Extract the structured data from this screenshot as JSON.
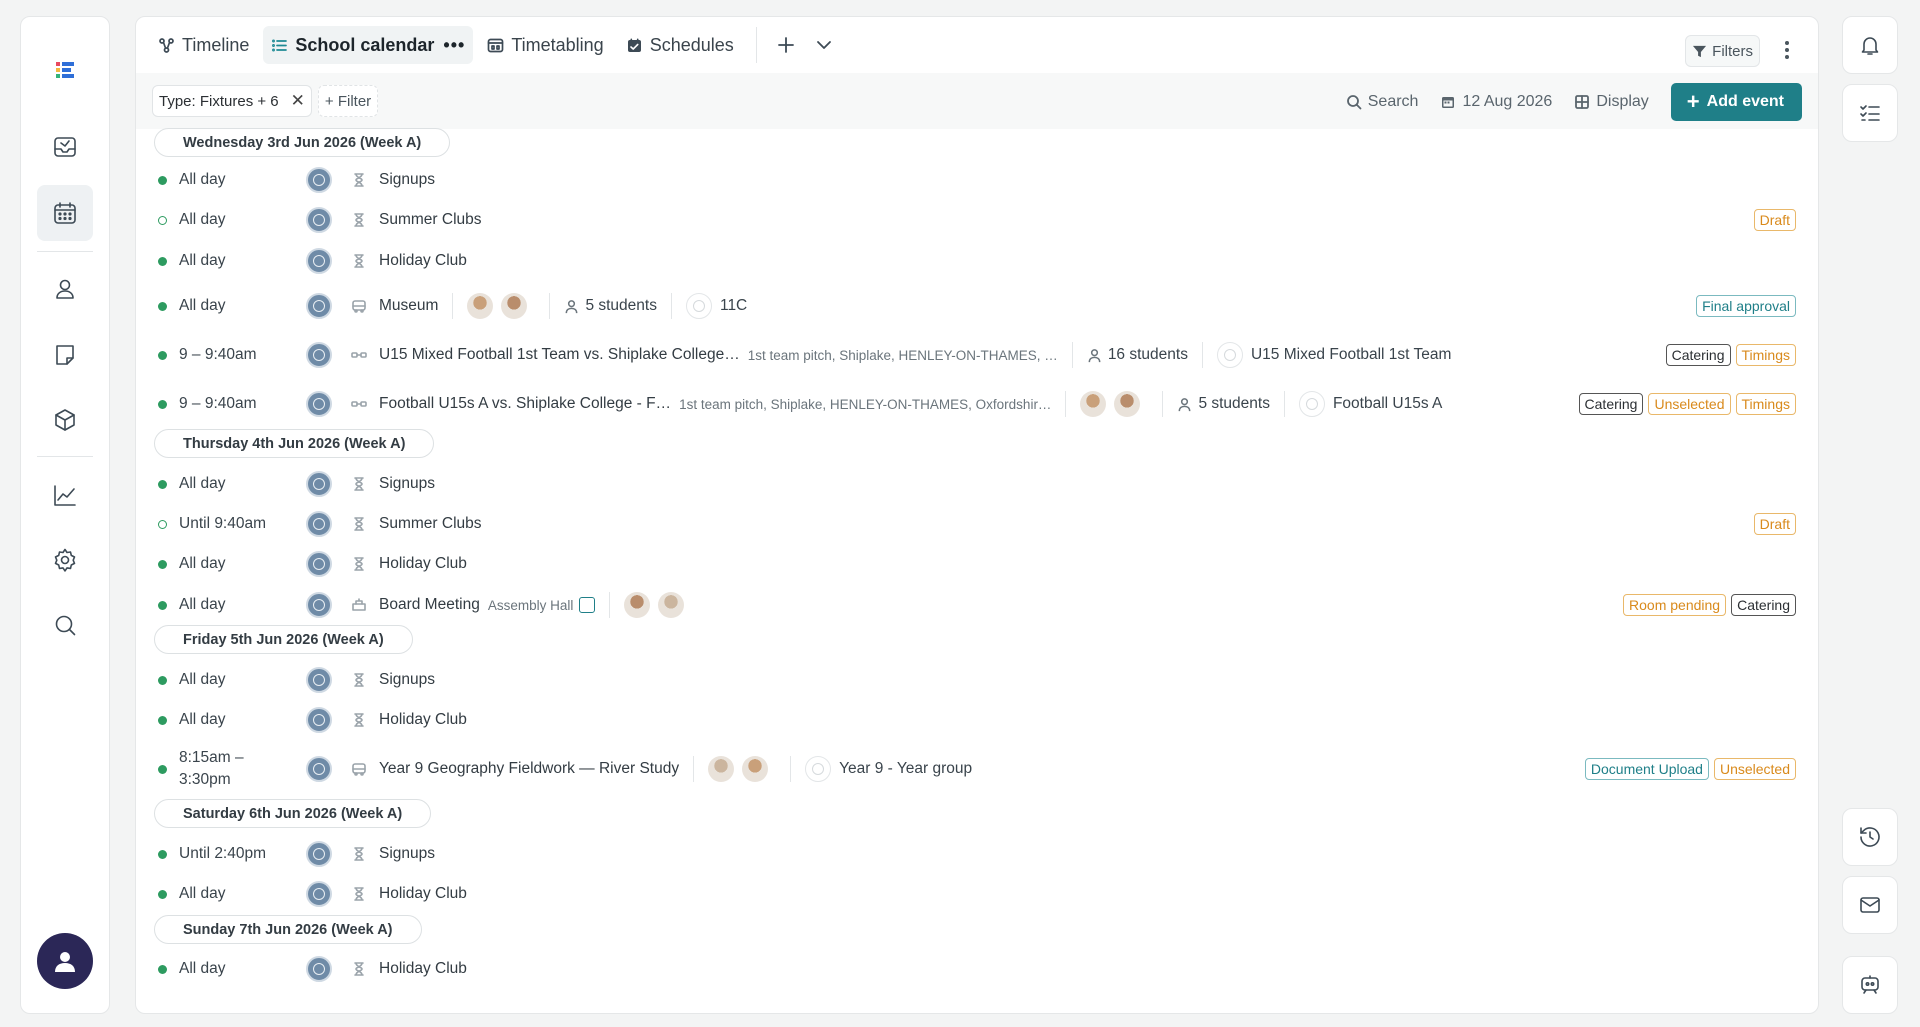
{
  "left_rail": {
    "items": [
      "app-logo",
      "inbox",
      "calendar",
      "people",
      "notes",
      "resources",
      "analytics",
      "settings",
      "search"
    ]
  },
  "tabs": [
    {
      "label": "Timeline",
      "icon": "timeline-icon"
    },
    {
      "label": "School calendar",
      "icon": "list-icon",
      "active": true,
      "more": "•••"
    },
    {
      "label": "Timetabling",
      "icon": "timetable-icon"
    },
    {
      "label": "Schedules",
      "icon": "calendar-check-icon"
    }
  ],
  "toolbar": {
    "filters_label": "Filters",
    "filter_chip": "Type: Fixtures + 6",
    "add_filter": "+ Filter",
    "search_label": "Search",
    "date_label": "12 Aug 2026",
    "display_label": "Display",
    "add_event_label": "Add event",
    "add_event_color": "#1f7f88"
  },
  "status_colors": {
    "filled": "#2d9b60",
    "orange": "#d98a1c",
    "teal": "#1f7f88"
  },
  "days": [
    {
      "header": "Wednesday 3rd Jun 2026 (Week A)",
      "events": [
        {
          "time": "All day",
          "status": "filled",
          "icon": "hourglass",
          "title": "Signups",
          "badges": []
        },
        {
          "time": "All day",
          "status": "hollow",
          "icon": "hourglass",
          "title": "Summer Clubs",
          "badges": [
            {
              "label": "Draft",
              "style": "orange"
            }
          ]
        },
        {
          "time": "All day",
          "status": "filled",
          "icon": "hourglass",
          "title": "Holiday Club",
          "badges": []
        },
        {
          "time": "All day",
          "status": "filled",
          "icon": "trip",
          "title": "Museum",
          "avatars": 2,
          "students": "5 students",
          "group": "11C",
          "badges": [
            {
              "label": "Final approval",
              "style": "teal"
            }
          ]
        },
        {
          "time": "9 – 9:40am",
          "status": "filled",
          "icon": "fixture",
          "title": "U15 Mixed Football 1st Team vs. Shiplake College…",
          "location": "1st team pitch, Shiplake, HENLEY-ON-THAMES, …",
          "students": "16 students",
          "team": "U15 Mixed Football 1st Team",
          "badges": [
            {
              "label": "Catering",
              "style": "dark"
            },
            {
              "label": "Timings",
              "style": "orange"
            }
          ]
        },
        {
          "time": "9 – 9:40am",
          "status": "filled",
          "icon": "fixture",
          "title": "Football U15s A vs. Shiplake College - F…",
          "location": "1st team pitch, Shiplake, HENLEY-ON-THAMES, Oxfordshir…",
          "avatars": 2,
          "students": "5 students",
          "team": "Football U15s A",
          "badges": [
            {
              "label": "Catering",
              "style": "dark"
            },
            {
              "label": "Unselected",
              "style": "orange"
            },
            {
              "label": "Timings",
              "style": "orange"
            }
          ]
        }
      ]
    },
    {
      "header": "Thursday 4th Jun 2026 (Week A)",
      "events": [
        {
          "time": "All day",
          "status": "filled",
          "icon": "hourglass",
          "title": "Signups",
          "badges": []
        },
        {
          "time": "Until 9:40am",
          "status": "hollow",
          "icon": "hourglass",
          "title": "Summer Clubs",
          "badges": [
            {
              "label": "Draft",
              "style": "orange"
            }
          ]
        },
        {
          "time": "All day",
          "status": "filled",
          "icon": "hourglass",
          "title": "Holiday Club",
          "badges": []
        },
        {
          "time": "All day",
          "status": "filled",
          "icon": "meeting",
          "title": "Board Meeting",
          "location": "Assembly Hall",
          "note": true,
          "avatars": 2,
          "badges": [
            {
              "label": "Room pending",
              "style": "orange"
            },
            {
              "label": "Catering",
              "style": "dark"
            }
          ]
        }
      ]
    },
    {
      "header": "Friday 5th Jun 2026 (Week A)",
      "events": [
        {
          "time": "All day",
          "status": "filled",
          "icon": "hourglass",
          "title": "Signups",
          "badges": []
        },
        {
          "time": "All day",
          "status": "filled",
          "icon": "hourglass",
          "title": "Holiday Club",
          "badges": []
        },
        {
          "time": "8:15am –",
          "time2": "3:30pm",
          "status": "filled",
          "icon": "trip",
          "title": "Year 9 Geography Fieldwork — River Study",
          "avatars": 2,
          "group": "Year 9 - Year group",
          "badges": [
            {
              "label": "Document Upload",
              "style": "teal"
            },
            {
              "label": "Unselected",
              "style": "orange"
            }
          ]
        }
      ]
    },
    {
      "header": "Saturday 6th Jun 2026 (Week A)",
      "events": [
        {
          "time": "Until 2:40pm",
          "status": "filled",
          "icon": "hourglass",
          "title": "Signups",
          "badges": []
        },
        {
          "time": "All day",
          "status": "filled",
          "icon": "hourglass",
          "title": "Holiday Club",
          "badges": []
        }
      ]
    },
    {
      "header": "Sunday 7th Jun 2026 (Week A)",
      "events": [
        {
          "time": "All day",
          "status": "filled",
          "icon": "hourglass",
          "title": "Holiday Club",
          "badges": []
        }
      ]
    }
  ]
}
